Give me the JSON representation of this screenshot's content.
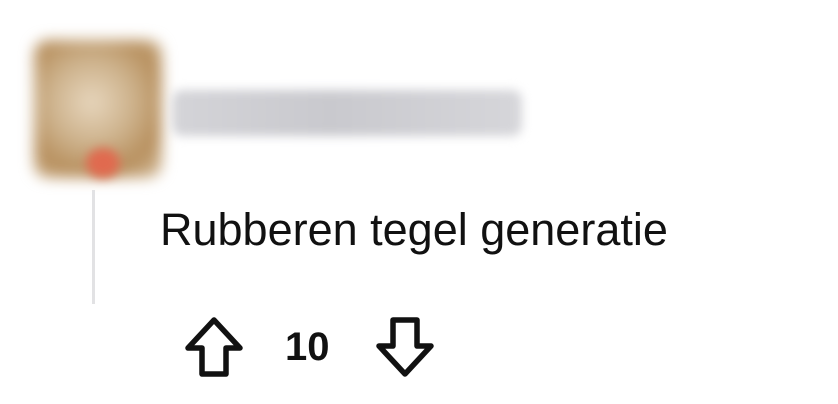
{
  "comment": {
    "author": "",
    "body": "Rubberen tegel generatie",
    "score": "10"
  },
  "icons": {
    "upvote": "arrow-up-outline-icon",
    "downvote": "arrow-down-outline-icon"
  },
  "colors": {
    "text": "#111111",
    "thread_line": "#e2e2e4"
  }
}
